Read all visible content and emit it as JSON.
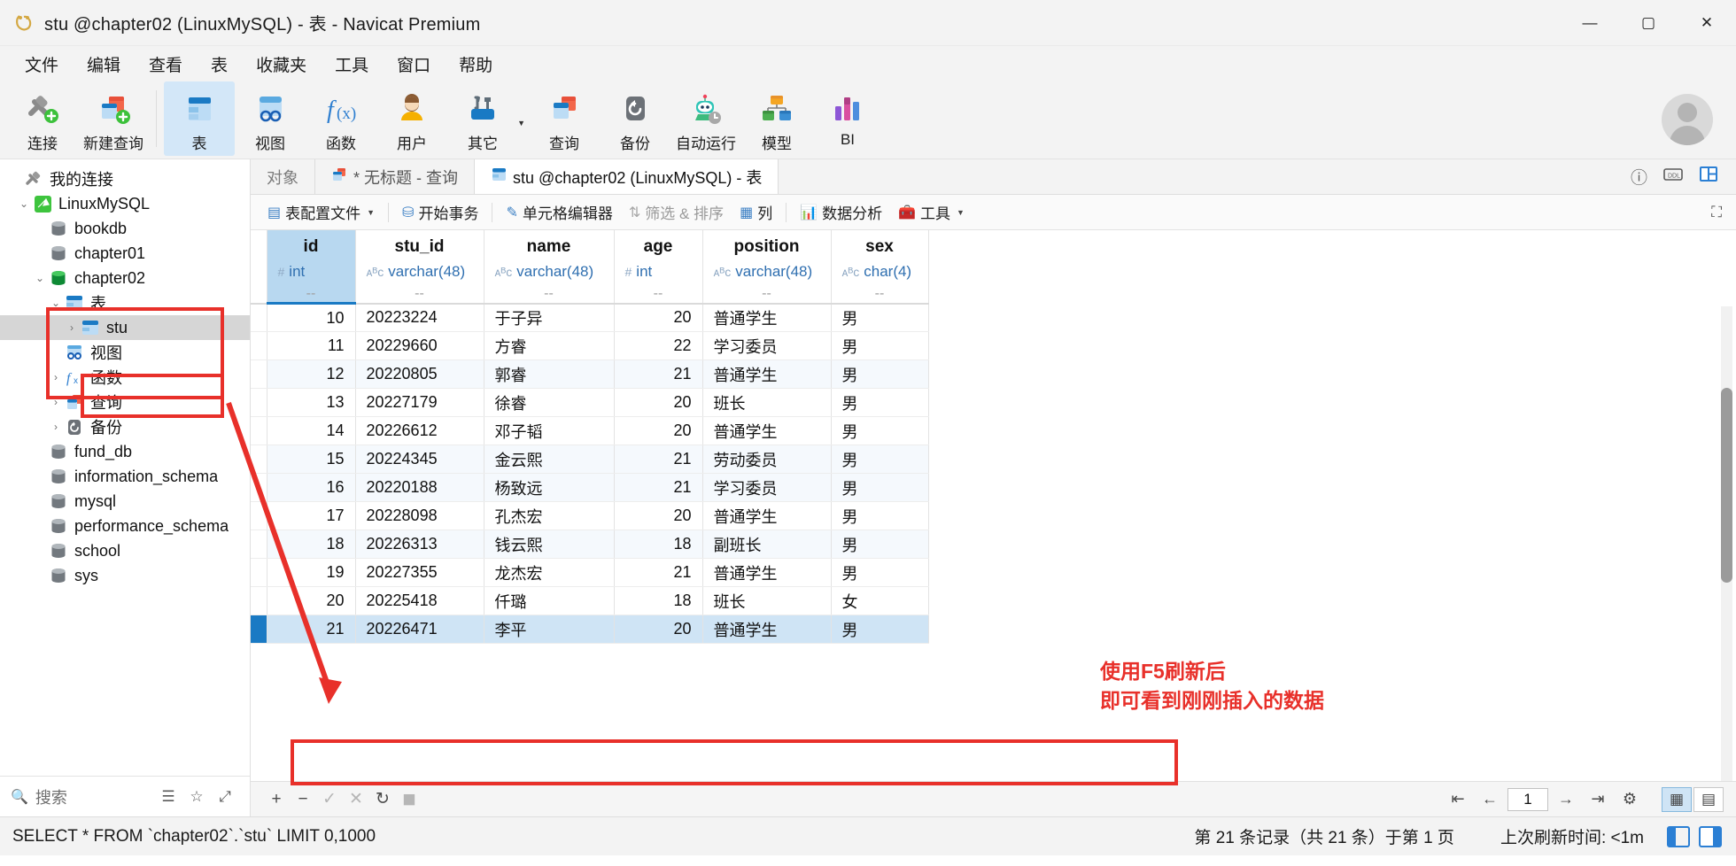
{
  "window": {
    "title": "stu @chapter02 (LinuxMySQL) - 表 - Navicat Premium",
    "minimize": "—",
    "maximize": "▢",
    "close": "✕"
  },
  "menu": [
    "文件",
    "编辑",
    "查看",
    "表",
    "收藏夹",
    "工具",
    "窗口",
    "帮助"
  ],
  "toolbar": {
    "items": [
      {
        "label": "连接",
        "icon": "connection-icon",
        "active": false,
        "caret": false
      },
      {
        "label": "新建查询",
        "icon": "new-query-icon",
        "active": false,
        "caret": false
      },
      {
        "label": "表",
        "icon": "table-icon",
        "active": true,
        "caret": false
      },
      {
        "label": "视图",
        "icon": "view-icon",
        "active": false,
        "caret": false
      },
      {
        "label": "函数",
        "icon": "function-icon",
        "active": false,
        "caret": false
      },
      {
        "label": "用户",
        "icon": "user-icon",
        "active": false,
        "caret": false
      },
      {
        "label": "其它",
        "icon": "others-icon",
        "active": false,
        "caret": true
      },
      {
        "label": "查询",
        "icon": "query-icon",
        "active": false,
        "caret": false
      },
      {
        "label": "备份",
        "icon": "backup-icon",
        "active": false,
        "caret": false
      },
      {
        "label": "自动运行",
        "icon": "automation-icon",
        "active": false,
        "caret": false
      },
      {
        "label": "模型",
        "icon": "model-icon",
        "active": false,
        "caret": false
      },
      {
        "label": "BI",
        "icon": "bi-icon",
        "active": false,
        "caret": false
      }
    ]
  },
  "sidebar": {
    "search_placeholder": "搜索",
    "filter_icon": "filter-icon",
    "star_icon": "star-icon",
    "collapse_icon": "collapse-icon",
    "nodes": [
      {
        "label": "我的连接",
        "icon": "connection-icon",
        "indent": 0,
        "arrow": "",
        "selected": false
      },
      {
        "label": "LinuxMySQL",
        "icon": "mysql-icon",
        "indent": 1,
        "arrow": "⌄",
        "selected": false
      },
      {
        "label": "bookdb",
        "icon": "db-gray-icon",
        "indent": 2,
        "arrow": "",
        "selected": false
      },
      {
        "label": "chapter01",
        "icon": "db-gray-icon",
        "indent": 2,
        "arrow": "",
        "selected": false
      },
      {
        "label": "chapter02",
        "icon": "db-green-icon",
        "indent": 2,
        "arrow": "⌄",
        "selected": false
      },
      {
        "label": "表",
        "icon": "table-icon",
        "indent": 3,
        "arrow": "⌄",
        "selected": false
      },
      {
        "label": "stu",
        "icon": "table-icon",
        "indent": 4,
        "arrow": "›",
        "selected": true
      },
      {
        "label": "视图",
        "icon": "view-icon",
        "indent": 3,
        "arrow": "",
        "selected": false
      },
      {
        "label": "函数",
        "icon": "function-icon",
        "indent": 3,
        "arrow": "›",
        "selected": false
      },
      {
        "label": "查询",
        "icon": "query-icon",
        "indent": 3,
        "arrow": "›",
        "selected": false
      },
      {
        "label": "备份",
        "icon": "backup-icon",
        "indent": 3,
        "arrow": "›",
        "selected": false
      },
      {
        "label": "fund_db",
        "icon": "db-gray-icon",
        "indent": 2,
        "arrow": "",
        "selected": false
      },
      {
        "label": "information_schema",
        "icon": "db-gray-icon",
        "indent": 2,
        "arrow": "",
        "selected": false
      },
      {
        "label": "mysql",
        "icon": "db-gray-icon",
        "indent": 2,
        "arrow": "",
        "selected": false
      },
      {
        "label": "performance_schema",
        "icon": "db-gray-icon",
        "indent": 2,
        "arrow": "",
        "selected": false
      },
      {
        "label": "school",
        "icon": "db-gray-icon",
        "indent": 2,
        "arrow": "",
        "selected": false
      },
      {
        "label": "sys",
        "icon": "db-gray-icon",
        "indent": 2,
        "arrow": "",
        "selected": false
      }
    ]
  },
  "tabs": [
    {
      "label": "对象",
      "icon": "",
      "active": false,
      "modified": false
    },
    {
      "label": "* 无标题 - 查询",
      "icon": "query-icon",
      "active": false,
      "modified": true
    },
    {
      "label": "stu @chapter02 (LinuxMySQL) - 表",
      "icon": "table-icon",
      "active": true,
      "modified": false
    }
  ],
  "tab_right_icons": [
    "info-icon",
    "ddl-icon",
    "grid-layout-icon"
  ],
  "gridtools": [
    {
      "label": "表配置文件",
      "icon": "profile-icon",
      "caret": true,
      "dim": false
    },
    {
      "label": "开始事务",
      "icon": "transaction-icon",
      "caret": false,
      "dim": false
    },
    {
      "label": "单元格编辑器",
      "icon": "cell-editor-icon",
      "caret": false,
      "dim": false
    },
    {
      "label": "筛选 & 排序",
      "icon": "filter-sort-icon",
      "caret": false,
      "dim": true
    },
    {
      "label": "列",
      "icon": "columns-icon",
      "caret": false,
      "dim": false
    },
    {
      "label": "数据分析",
      "icon": "analysis-icon",
      "caret": false,
      "dim": false
    },
    {
      "label": "工具",
      "icon": "tools-icon",
      "caret": true,
      "dim": false
    }
  ],
  "fullscreen_icon": "fullscreen-icon",
  "grid": {
    "columns": [
      {
        "name": "id",
        "type": "int",
        "type_kind": "#",
        "placeholder": "--",
        "align": "right",
        "cls": "col-id"
      },
      {
        "name": "stu_id",
        "type": "varchar(48)",
        "type_kind": "ᴀᴮᴄ",
        "placeholder": "--",
        "align": "left",
        "cls": "col-stu"
      },
      {
        "name": "name",
        "type": "varchar(48)",
        "type_kind": "ᴀᴮᴄ",
        "placeholder": "--",
        "align": "left",
        "cls": "col-name"
      },
      {
        "name": "age",
        "type": "int",
        "type_kind": "#",
        "placeholder": "--",
        "align": "right",
        "cls": "col-age"
      },
      {
        "name": "position",
        "type": "varchar(48)",
        "type_kind": "ᴀᴮᴄ",
        "placeholder": "--",
        "align": "left",
        "cls": "col-pos"
      },
      {
        "name": "sex",
        "type": "char(4)",
        "type_kind": "ᴀᴮᴄ",
        "placeholder": "--",
        "align": "left",
        "cls": "col-sex"
      }
    ],
    "rows": [
      {
        "id": "10",
        "stu_id": "20223224",
        "name": "于子异",
        "age": "20",
        "position": "普通学生",
        "sex": "男",
        "selected": false
      },
      {
        "id": "11",
        "stu_id": "20229660",
        "name": "方睿",
        "age": "22",
        "position": "学习委员",
        "sex": "男",
        "selected": false
      },
      {
        "id": "12",
        "stu_id": "20220805",
        "name": "郭睿",
        "age": "21",
        "position": "普通学生",
        "sex": "男",
        "selected": false
      },
      {
        "id": "13",
        "stu_id": "20227179",
        "name": "徐睿",
        "age": "20",
        "position": "班长",
        "sex": "男",
        "selected": false
      },
      {
        "id": "14",
        "stu_id": "20226612",
        "name": "邓子韬",
        "age": "20",
        "position": "普通学生",
        "sex": "男",
        "selected": false
      },
      {
        "id": "15",
        "stu_id": "20224345",
        "name": "金云熙",
        "age": "21",
        "position": "劳动委员",
        "sex": "男",
        "selected": false
      },
      {
        "id": "16",
        "stu_id": "20220188",
        "name": "杨致远",
        "age": "21",
        "position": "学习委员",
        "sex": "男",
        "selected": false
      },
      {
        "id": "17",
        "stu_id": "20228098",
        "name": "孔杰宏",
        "age": "20",
        "position": "普通学生",
        "sex": "男",
        "selected": false
      },
      {
        "id": "18",
        "stu_id": "20226313",
        "name": "钱云熙",
        "age": "18",
        "position": "副班长",
        "sex": "男",
        "selected": false
      },
      {
        "id": "19",
        "stu_id": "20227355",
        "name": "龙杰宏",
        "age": "21",
        "position": "普通学生",
        "sex": "男",
        "selected": false
      },
      {
        "id": "20",
        "stu_id": "20225418",
        "name": "仟璐",
        "age": "18",
        "position": "班长",
        "sex": "女",
        "selected": false
      },
      {
        "id": "21",
        "stu_id": "20226471",
        "name": "李平",
        "age": "20",
        "position": "普通学生",
        "sex": "男",
        "selected": true
      }
    ]
  },
  "gridfoot": {
    "buttons": [
      "+",
      "−",
      "✓",
      "✕",
      "↻",
      "◼"
    ],
    "nav": [
      "⇤",
      "←"
    ],
    "page_value": "1",
    "nav_right": [
      "→",
      "⇥",
      "⚙"
    ],
    "view_grid_icon": "grid-view-icon",
    "view_form_icon": "form-view-icon"
  },
  "statusbar": {
    "sql": "SELECT * FROM `chapter02`.`stu` LIMIT 0,1000",
    "record_info": "第 21 条记录（共 21 条）于第 1 页",
    "refresh_info": "上次刷新时间: <1m"
  },
  "annotations": {
    "note_line1": "使用F5刷新后",
    "note_line2": "即可看到刚刚插入的数据",
    "color": "#e8302a"
  }
}
